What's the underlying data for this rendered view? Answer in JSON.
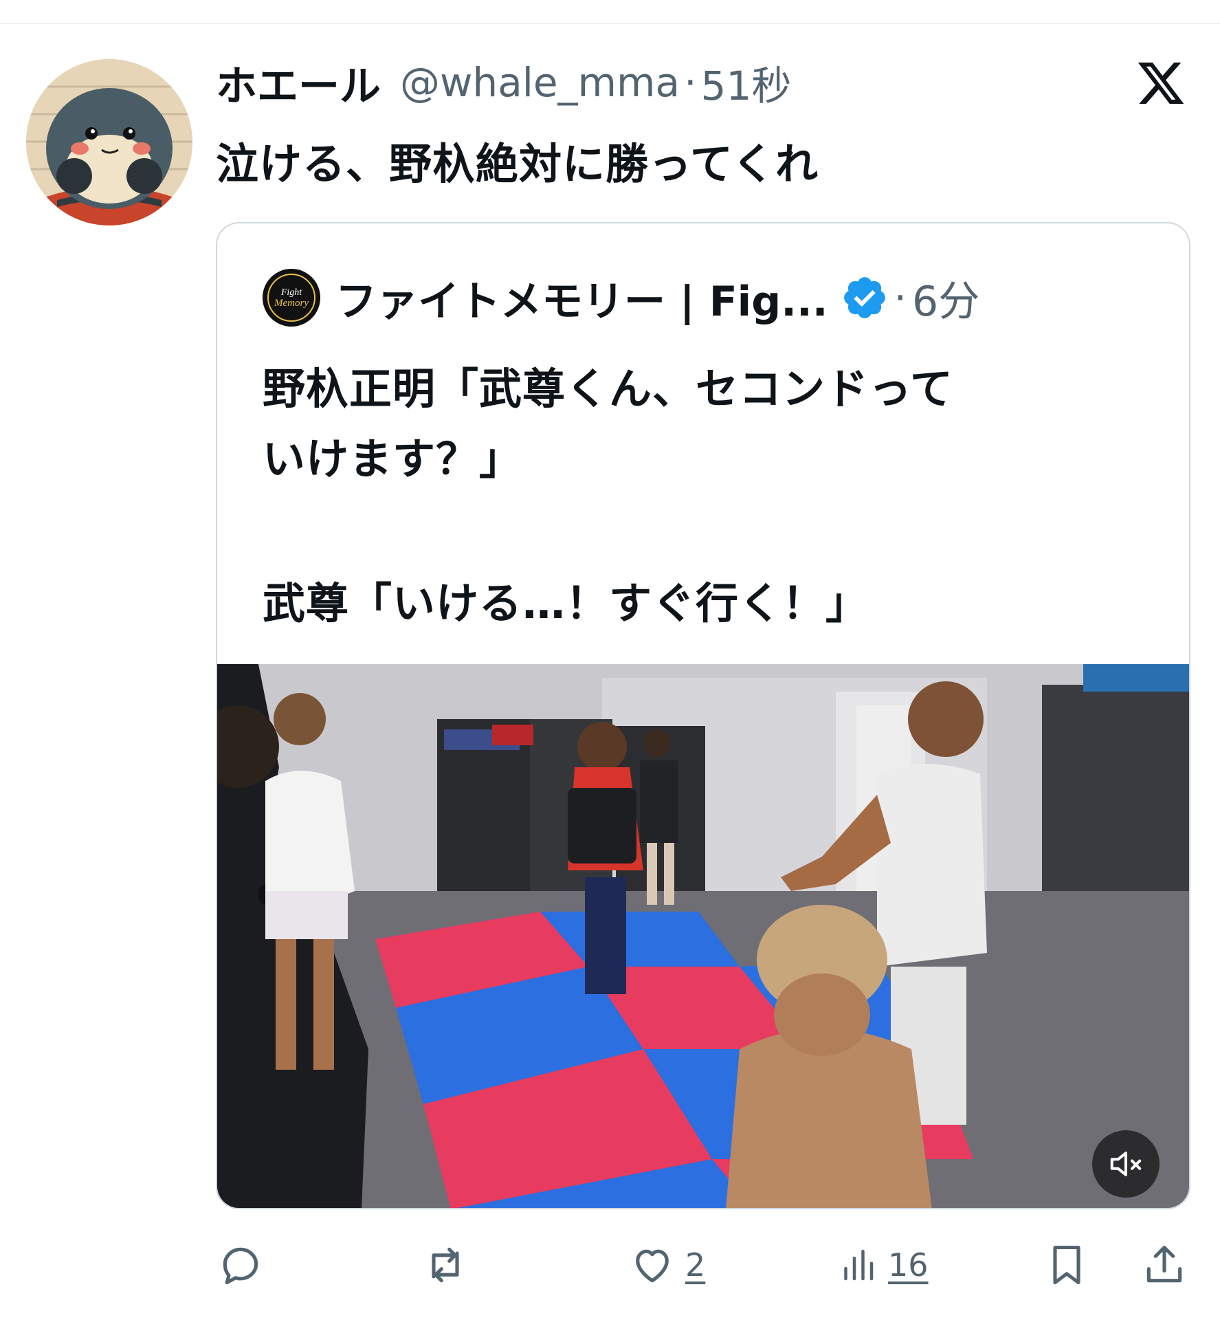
{
  "tweet": {
    "display_name": "ホエール",
    "handle": "@whale_mma",
    "separator": "·",
    "time": "51秒",
    "text": "泣ける、野杁絶対に勝ってくれ"
  },
  "quoted": {
    "display_name": "ファイトメモリー | Fig...",
    "avatar_text": "Fight Memory",
    "separator": "·",
    "time": "6分",
    "verified": true,
    "text_lines": [
      "野杁正明「武尊くん、セコンドって",
      "いけます？」",
      "",
      "武尊「いける…！すぐ行く！」"
    ]
  },
  "actions": {
    "reply_icon": "reply-icon",
    "retweet_icon": "retweet-icon",
    "like_count": "2",
    "views_count": "16",
    "bookmark_icon": "bookmark-icon",
    "share_icon": "share-icon"
  },
  "colors": {
    "text_primary": "#0f1419",
    "text_secondary": "#536471",
    "verified_blue": "#1d9bf0",
    "border": "#cfd9de"
  }
}
